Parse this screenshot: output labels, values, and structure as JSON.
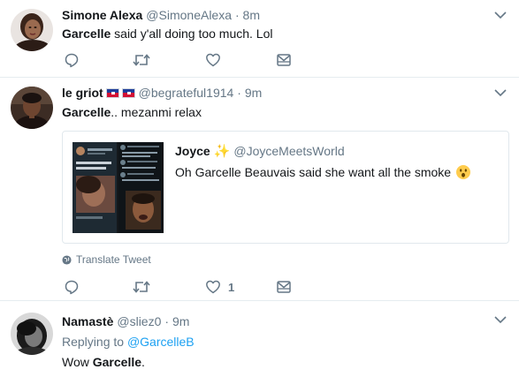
{
  "tweets": [
    {
      "name": "Simone Alexa",
      "handle": "@SimoneAlexa",
      "time": "· 8m",
      "text_bold": "Garcelle",
      "text_rest": " said y'all doing too much. Lol"
    },
    {
      "name": "le griot",
      "handle": "@begrateful1914",
      "time": "· 9m",
      "text_bold": "Garcelle",
      "text_rest": ".. mezanmi relax",
      "quote": {
        "name": "Joyce",
        "handle": "@JoyceMeetsWorld",
        "text": "Oh Garcelle Beauvais said she want all the smoke",
        "emoji": "hushed-face-icon"
      },
      "translate": "Translate Tweet",
      "like_count": "1"
    },
    {
      "name": "Namastè",
      "handle": "@sliez0",
      "time": "· 9m",
      "replying_prefix": "Replying to ",
      "replying_to": "@GarcelleB",
      "text_pre": "Wow ",
      "text_bold": "Garcelle",
      "text_post": "."
    }
  ],
  "colors": {
    "muted": "#657786",
    "link": "#1da1f2",
    "border": "#e6ecf0",
    "text": "#14171a"
  }
}
